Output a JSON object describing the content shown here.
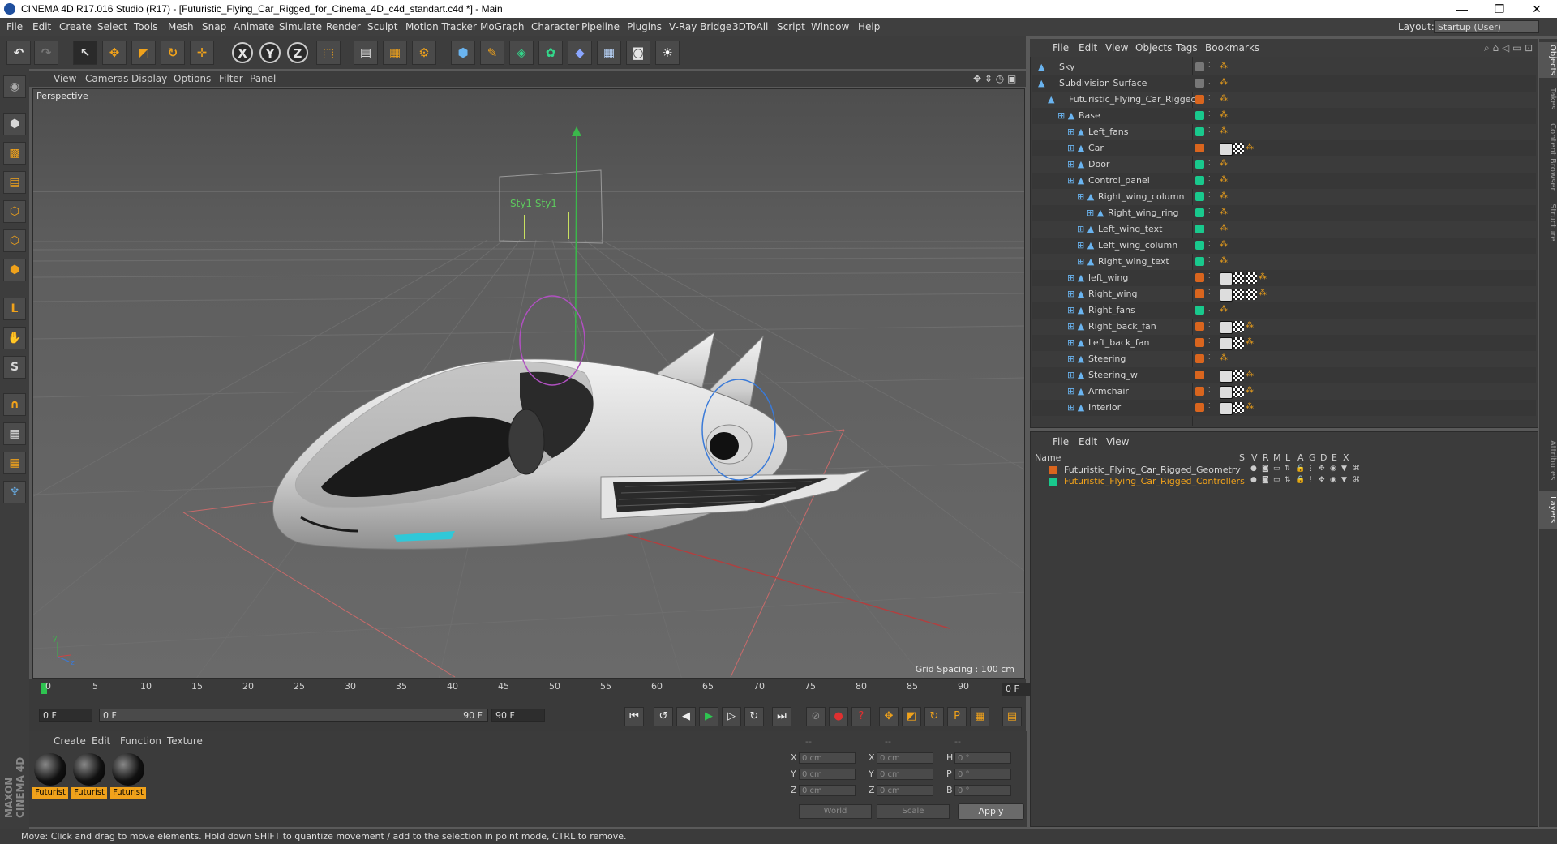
{
  "window": {
    "title": "CINEMA 4D R17.016 Studio (R17) - [Futuristic_Flying_Car_Rigged_for_Cinema_4D_c4d_standart.c4d *] - Main",
    "minimize": "—",
    "maximize": "❐",
    "close": "✕"
  },
  "menubar": {
    "items": [
      "File",
      "Edit",
      "Create",
      "Select",
      "Tools",
      "Mesh",
      "Snap",
      "Animate",
      "Simulate",
      "Render",
      "Sculpt",
      "Motion Tracker",
      "MoGraph",
      "Character",
      "Pipeline",
      "Plugins",
      "V-Ray Bridge",
      "3DToAll",
      "Script",
      "Window",
      "Help"
    ],
    "layout_label": "Layout:",
    "layout_value": "Startup (User)"
  },
  "viewport": {
    "menu": [
      "View",
      "Cameras",
      "Display",
      "Options",
      "Filter",
      "Panel"
    ],
    "name": "Perspective",
    "grid_spacing": "Grid Spacing : 100 cm",
    "axis_y": "y",
    "axis_z": "z",
    "billboard_text": "Sty1   Sty1"
  },
  "timeline": {
    "ticks": [
      "0",
      "5",
      "10",
      "15",
      "20",
      "25",
      "30",
      "35",
      "40",
      "45",
      "50",
      "55",
      "60",
      "65",
      "70",
      "75",
      "80",
      "85",
      "90"
    ],
    "end_frame": "0 F"
  },
  "transport": {
    "current": "0 F",
    "range_start": "0 F",
    "range_end": "90 F",
    "max": "90 F"
  },
  "material_manager": {
    "menu": [
      "Create",
      "Edit",
      "Function",
      "Texture"
    ],
    "materials": [
      "Futurist",
      "Futurist",
      "Futurist"
    ]
  },
  "coordinates": {
    "header": [
      "--",
      "--",
      "--"
    ],
    "rows": [
      {
        "a": "X",
        "av": "0 cm",
        "b": "X",
        "bv": "0 cm",
        "c": "H",
        "cv": "0 °"
      },
      {
        "a": "Y",
        "av": "0 cm",
        "b": "Y",
        "bv": "0 cm",
        "c": "P",
        "cv": "0 °"
      },
      {
        "a": "Z",
        "av": "0 cm",
        "b": "Z",
        "bv": "0 cm",
        "c": "B",
        "cv": "0 °"
      }
    ],
    "world": "World",
    "scale": "Scale",
    "apply": "Apply"
  },
  "status": "Move: Click and drag to move elements. Hold down SHIFT to quantize movement / add to the selection in point mode, CTRL to remove.",
  "maxon": "MAXON CINEMA 4D",
  "object_manager": {
    "menu": [
      "File",
      "Edit",
      "View",
      "Objects",
      "Tags",
      "Bookmarks"
    ],
    "objects": [
      {
        "name": "Sky",
        "color": "#777777",
        "indent": 0
      },
      {
        "name": "Subdivision Surface",
        "color": "#777777",
        "indent": 0
      },
      {
        "name": "Futuristic_Flying_Car_Rigged",
        "color": "#d9651e",
        "indent": 1
      },
      {
        "name": "Base",
        "color": "#19c98d",
        "indent": 2
      },
      {
        "name": "Left_fans",
        "color": "#19c98d",
        "indent": 3
      },
      {
        "name": "Car",
        "color": "#d9651e",
        "indent": 3
      },
      {
        "name": "Door",
        "color": "#19c98d",
        "indent": 3
      },
      {
        "name": "Control_panel",
        "color": "#19c98d",
        "indent": 3
      },
      {
        "name": "Right_wing_column",
        "color": "#19c98d",
        "indent": 4
      },
      {
        "name": "Right_wing_ring",
        "color": "#19c98d",
        "indent": 5
      },
      {
        "name": "Left_wing_text",
        "color": "#19c98d",
        "indent": 4
      },
      {
        "name": "Left_wing_column",
        "color": "#19c98d",
        "indent": 4
      },
      {
        "name": "Right_wing_text",
        "color": "#19c98d",
        "indent": 4
      },
      {
        "name": "left_wing",
        "color": "#d9651e",
        "indent": 3
      },
      {
        "name": "Right_wing",
        "color": "#d9651e",
        "indent": 3
      },
      {
        "name": "Right_fans",
        "color": "#19c98d",
        "indent": 3
      },
      {
        "name": "Right_back_fan",
        "color": "#d9651e",
        "indent": 3
      },
      {
        "name": "Left_back_fan",
        "color": "#d9651e",
        "indent": 3
      },
      {
        "name": "Steering",
        "color": "#d9651e",
        "indent": 3
      },
      {
        "name": "Steering_w",
        "color": "#d9651e",
        "indent": 3
      },
      {
        "name": "Armchair",
        "color": "#d9651e",
        "indent": 3
      },
      {
        "name": "Interior",
        "color": "#d9651e",
        "indent": 3
      }
    ]
  },
  "layer_manager": {
    "menu": [
      "File",
      "Edit",
      "View"
    ],
    "columns": [
      "Name",
      "S",
      "V",
      "R",
      "M",
      "L",
      "A",
      "G",
      "D",
      "E",
      "X"
    ],
    "layers": [
      {
        "name": "Futuristic_Flying_Car_Rigged_Geometry",
        "color": "#d9651e",
        "text_color": "#d6d6d6"
      },
      {
        "name": "Futuristic_Flying_Car_Rigged_Controllers",
        "color": "#19c98d",
        "text_color": "#f0a21b"
      }
    ]
  },
  "right_tabs": [
    "Objects",
    "Takes",
    "Content Browser",
    "Structure",
    "Attributes",
    "Layers"
  ]
}
